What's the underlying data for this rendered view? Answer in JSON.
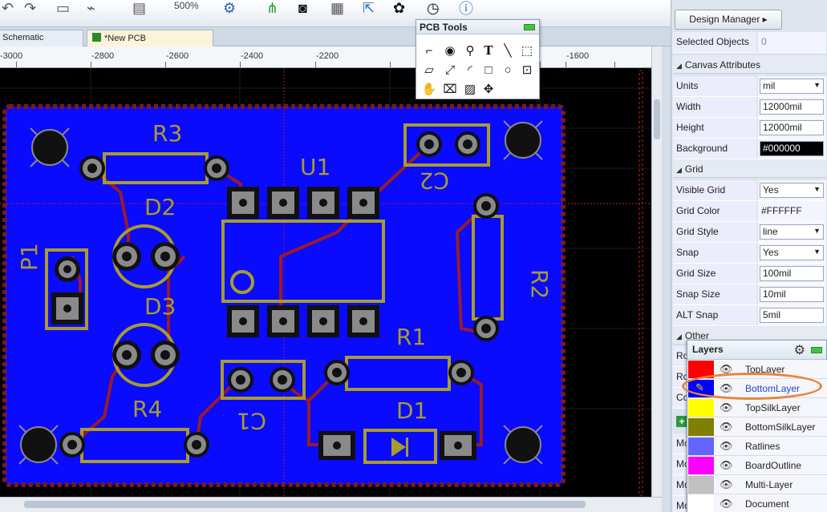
{
  "toolbar": {
    "zoom": "500%",
    "icons": [
      "undo-icon",
      "redo-icon",
      "copy-icon",
      "wire-icon",
      "layers-icon",
      "gear-icon",
      "share-icon",
      "camera-icon",
      "chip-icon",
      "export-icon",
      "help-icon",
      "history-icon",
      "info-icon"
    ]
  },
  "tabs": [
    {
      "label": "Schematic"
    },
    {
      "label": "*New PCB"
    }
  ],
  "ruler": {
    "ticks": [
      "-3000",
      "-2800",
      "-2600",
      "-2400",
      "-2200",
      "-1600"
    ]
  },
  "pcb_tools": {
    "title": "PCB Tools",
    "tools": [
      "track-icon",
      "pad-icon",
      "via-icon",
      "text-icon",
      "line-icon",
      "copper-area-icon",
      "solid-region-icon",
      "dimension-icon",
      "arc-icon",
      "rect-icon",
      "circle-icon",
      "hole-icon",
      "pan-icon",
      "no-connect-icon",
      "image-icon",
      "move-icon"
    ]
  },
  "pcb": {
    "board_color": "#0000ff",
    "silk_color": "#a89c2c",
    "components": [
      "R3",
      "U1",
      "C2",
      "D2",
      "P1",
      "D3",
      "R2",
      "R1",
      "R4",
      "D1",
      "C1"
    ]
  },
  "side": {
    "design_manager": "Design Manager ▸",
    "selected_objects": {
      "label": "Selected Objects",
      "value": "0"
    },
    "canvas_section": "Canvas Attributes",
    "canvas": [
      {
        "label": "Units",
        "value": "mil",
        "select": true
      },
      {
        "label": "Width",
        "value": "12000mil"
      },
      {
        "label": "Height",
        "value": "12000mil"
      },
      {
        "label": "Background",
        "value": "#000000",
        "swatch": true
      }
    ],
    "grid_section": "Grid",
    "grid": [
      {
        "label": "Visible Grid",
        "value": "Yes",
        "select": true
      },
      {
        "label": "Grid Color",
        "value": "#FFFFFF",
        "plain": true
      },
      {
        "label": "Grid Style",
        "value": "line",
        "select": true
      },
      {
        "label": "Snap",
        "value": "Yes",
        "select": true
      },
      {
        "label": "Grid Size",
        "value": "100mil"
      },
      {
        "label": "Snap Size",
        "value": "10mil"
      },
      {
        "label": "ALT Snap",
        "value": "5mil"
      }
    ],
    "other_section": "Other",
    "other_labels": [
      "Ro",
      "Ro",
      "Co"
    ],
    "lower_labels": [
      "Mo",
      "Mo",
      "Mo",
      "Mo"
    ]
  },
  "layers": {
    "title": "Layers",
    "rows": [
      {
        "name": "TopLayer",
        "color": "#ff0000"
      },
      {
        "name": "BottomLayer",
        "color": "#0000ff",
        "active": true
      },
      {
        "name": "TopSilkLayer",
        "color": "#ffff00"
      },
      {
        "name": "BottomSilkLayer",
        "color": "#808000"
      },
      {
        "name": "Ratlines",
        "color": "#6464ff"
      },
      {
        "name": "BoardOutline",
        "color": "#ff00ff"
      },
      {
        "name": "Multi-Layer",
        "color": "#c0c0c0"
      },
      {
        "name": "Document",
        "color": "#ffffff"
      }
    ]
  }
}
